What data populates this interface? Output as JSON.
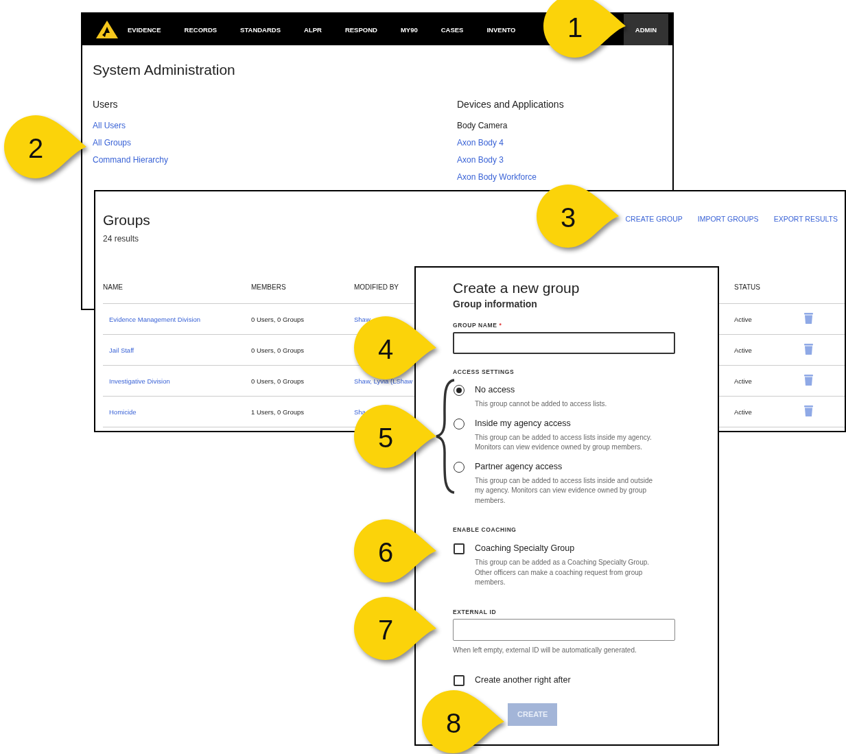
{
  "admin_window": {
    "nav": [
      {
        "label": "EVIDENCE",
        "selected": false
      },
      {
        "label": "RECORDS",
        "selected": false
      },
      {
        "label": "STANDARDS",
        "selected": false
      },
      {
        "label": "ALPR",
        "selected": false
      },
      {
        "label": "RESPOND",
        "selected": false
      },
      {
        "label": "MY90",
        "selected": false
      },
      {
        "label": "CASES",
        "selected": false
      },
      {
        "label": "INVENTO",
        "selected": false
      },
      {
        "label": "ADMIN",
        "selected": true
      }
    ],
    "title": "System Administration",
    "sections": [
      {
        "heading": "Users",
        "links": [
          "All Users",
          "All Groups",
          "Command Hierarchy"
        ]
      },
      {
        "heading": "Devices and Applications",
        "subheading": "Body Camera",
        "links": [
          "Axon Body 4",
          "Axon Body 3",
          "Axon Body Workforce"
        ]
      }
    ]
  },
  "groups_window": {
    "title": "Groups",
    "count": "24 results",
    "actions": [
      "CREATE GROUP",
      "IMPORT GROUPS",
      "EXPORT RESULTS"
    ],
    "columns": [
      "NAME",
      "MEMBERS",
      "MODIFIED BY",
      "STATUS"
    ],
    "rows": [
      {
        "name": "Evidence Management Division",
        "members": "0 Users, 0 Groups",
        "modified_by": "Shaw,",
        "status": "Active"
      },
      {
        "name": "Jail Staff",
        "members": "0 Users, 0 Groups",
        "status": "Active"
      },
      {
        "name": "Investigative Division",
        "members": "0 Users, 0 Groups",
        "modified_by": "Shaw, Lyvia (LShaw",
        "status": "Active"
      },
      {
        "name": "Homicide",
        "members": "1 Users, 0 Groups",
        "modified_by": "Sha",
        "status": "Active"
      }
    ]
  },
  "dialog": {
    "title": "Create a new group",
    "subtitle": "Group information",
    "group_name": {
      "label": "GROUP NAME",
      "required_mark": "*"
    },
    "access": {
      "label": "ACCESS SETTINGS",
      "options": [
        {
          "label": "No access",
          "description": "This group cannot be added to access lists.",
          "selected": true
        },
        {
          "label": "Inside my agency access",
          "description": "This group can be added to access lists inside my agency. Monitors can view evidence owned by group members.",
          "selected": false
        },
        {
          "label": "Partner agency access",
          "description": "This group can be added to access lists inside and outside my agency. Monitors can view evidence owned by group members.",
          "selected": false
        }
      ]
    },
    "coaching": {
      "label": "ENABLE COACHING",
      "option": {
        "label": "Coaching Specialty Group",
        "description": "This group can be added as a Coaching Specialty Group. Other officers can make a coaching request from group members.",
        "checked": false
      }
    },
    "external_id": {
      "label": "EXTERNAL ID",
      "hint": "When left empty, external ID will be automatically generated."
    },
    "create_another": {
      "label": "Create another right after",
      "checked": false
    },
    "create_button": {
      "label": "CREATE",
      "disabled": true
    }
  },
  "callouts": [
    "1",
    "2",
    "3",
    "4",
    "5",
    "6",
    "7",
    "8"
  ]
}
